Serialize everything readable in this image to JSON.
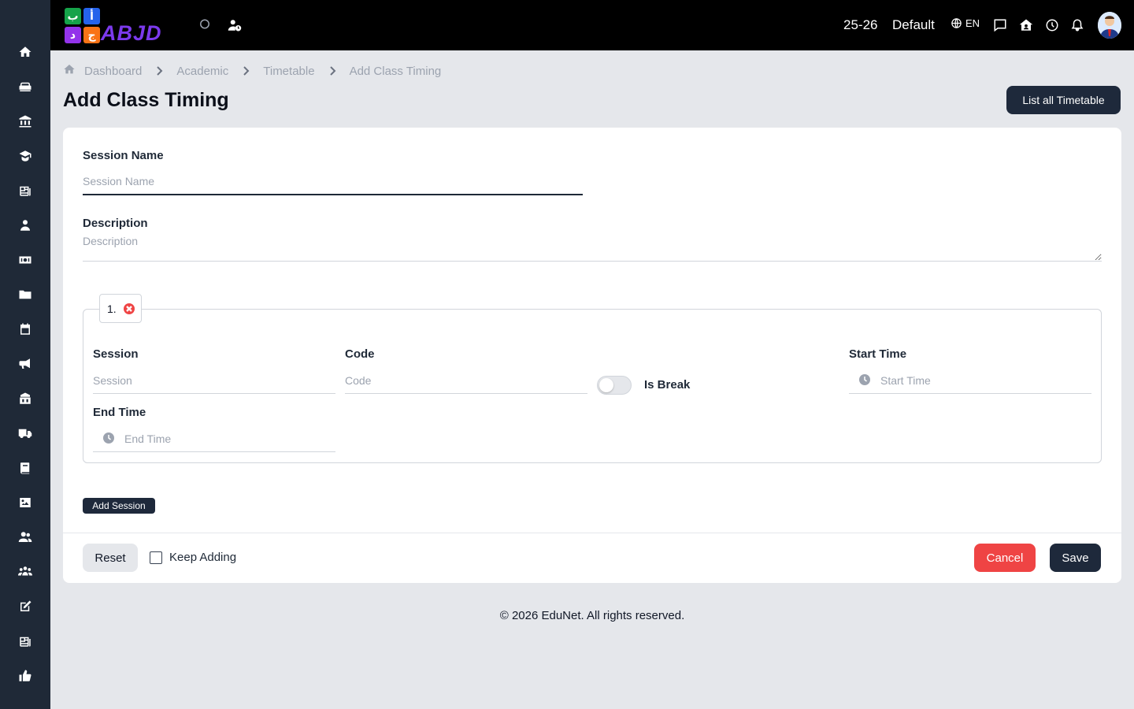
{
  "topbar": {
    "logo_text": "ABJD",
    "logo_letters": [
      "ب",
      "أ",
      "د",
      "ج"
    ],
    "session_year": "25-26",
    "profile": "Default",
    "language": "EN"
  },
  "breadcrumb": [
    "Dashboard",
    "Academic",
    "Timetable",
    "Add Class Timing"
  ],
  "page": {
    "title": "Add Class Timing",
    "list_button": "List all Timetable"
  },
  "form": {
    "session_name": {
      "label": "Session Name",
      "placeholder": "Session Name",
      "value": ""
    },
    "description": {
      "label": "Description",
      "placeholder": "Description",
      "value": ""
    },
    "session_block": {
      "index_label": "1.",
      "session": {
        "label": "Session",
        "placeholder": "Session"
      },
      "code": {
        "label": "Code",
        "placeholder": "Code"
      },
      "is_break": {
        "label": "Is Break",
        "checked": false
      },
      "start_time": {
        "label": "Start Time",
        "placeholder": "Start Time"
      },
      "end_time": {
        "label": "End Time",
        "placeholder": "End Time"
      }
    },
    "add_session_button": "Add Session",
    "reset_button": "Reset",
    "keep_adding_label": "Keep Adding",
    "keep_adding_checked": false,
    "cancel_button": "Cancel",
    "save_button": "Save"
  },
  "footer": "© 2026 EduNet. All rights reserved.",
  "colors": {
    "sidebar": "#1f2937",
    "topbar": "#000000",
    "primary_button": "#1e293b",
    "danger_button": "#ef4444",
    "background": "#e5e7eb"
  },
  "sidebar_icons": [
    "home-icon",
    "sofa-icon",
    "bank-icon",
    "graduate-icon",
    "newspaper-icon",
    "user-icon",
    "money-icon",
    "folder-icon",
    "calendar-icon",
    "megaphone-icon",
    "school-icon",
    "truck-icon",
    "book-icon",
    "image-icon",
    "users-icon",
    "group-icon",
    "edit-icon",
    "news-icon",
    "thumbs-up-icon"
  ]
}
